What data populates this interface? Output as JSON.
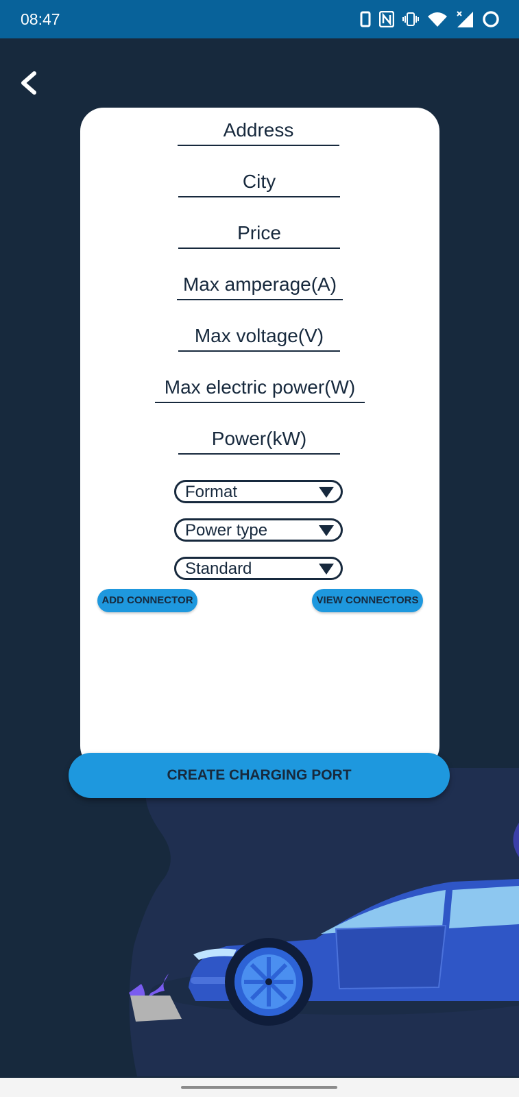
{
  "status_bar": {
    "time": "08:47",
    "icons": [
      "phone-icon",
      "nfc-icon",
      "vibrate-icon",
      "wifi-icon",
      "signal-icon",
      "battery-icon"
    ]
  },
  "header": {
    "back_icon": "chevron-left-icon"
  },
  "form": {
    "fields": [
      {
        "label": "Address"
      },
      {
        "label": "City"
      },
      {
        "label": "Price"
      },
      {
        "label": "Max amperage(A)"
      },
      {
        "label": "Max voltage(V)"
      },
      {
        "label": "Max electric power(W)"
      },
      {
        "label": "Power(kW)"
      }
    ],
    "selects": [
      {
        "value": "Format"
      },
      {
        "value": "Power type"
      },
      {
        "value": "Standard"
      }
    ],
    "add_connector_label": "ADD CONNECTOR",
    "view_connectors_label": "VIEW CONNECTORS"
  },
  "create_button_label": "CREATE CHARGING PORT",
  "colors": {
    "background": "#17293d",
    "status_bar": "#08629a",
    "accent": "#1e98de",
    "card": "#ffffff",
    "car_body": "#2f56c6"
  }
}
